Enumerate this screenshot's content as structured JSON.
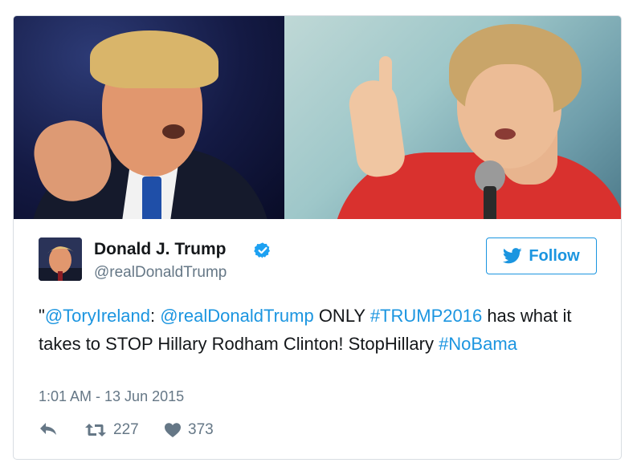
{
  "author": {
    "name": "Donald J. Trump",
    "handle": "@realDonaldTrump"
  },
  "follow_label": "Follow",
  "tweet": {
    "quote_open": "\"",
    "mention1": "@ToryIreland",
    "sep": ": ",
    "mention2": "@realDonaldTrump",
    "text1": " ONLY ",
    "hashtag1": "#TRUMP2016",
    "text2": " has what it takes to STOP Hillary Rodham Clinton! StopHillary ",
    "hashtag2": "#NoBama"
  },
  "timestamp": "1:01 AM - 13 Jun 2015",
  "actions": {
    "retweets": "227",
    "likes": "373"
  },
  "colors": {
    "link": "#1b95e0",
    "text": "#14171a",
    "muted": "#657786",
    "verified": "#1da1f2"
  },
  "icons": [
    "reply-icon",
    "retweet-icon",
    "heart-icon",
    "twitter-bird-icon",
    "verified-badge-icon"
  ]
}
